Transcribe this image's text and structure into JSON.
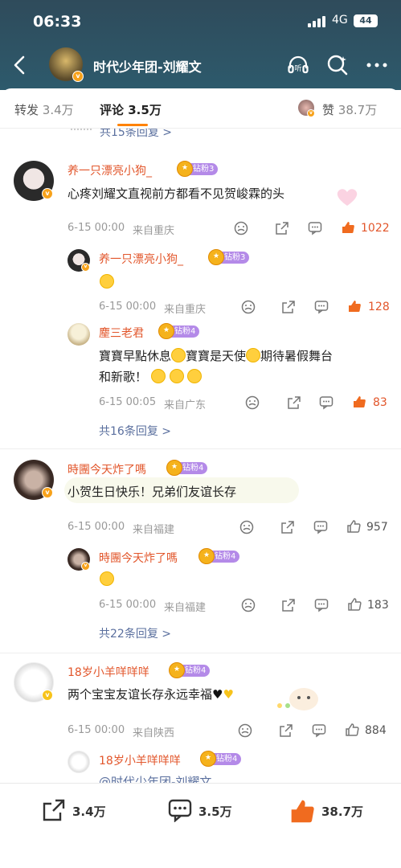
{
  "status_bar": {
    "time": "06:33",
    "network": "4G",
    "battery": "44"
  },
  "nav": {
    "title": "时代少年团-刘耀文",
    "icons": [
      "back-icon",
      "listen-icon",
      "search-icon",
      "more-icon"
    ],
    "listen_label": "听"
  },
  "tabs": {
    "repost_label": "转发",
    "repost_count": "3.4万",
    "comment_label": "评论",
    "comment_count": "3.5万",
    "like_label": "赞",
    "like_count": "38.7万"
  },
  "colors": {
    "accent": "#ff8200",
    "username": "#e2562b",
    "link": "#5a6f9e",
    "fan_badge": "#b48ae8"
  },
  "top_partial": {
    "replies": "共15条回复 >"
  },
  "comments": [
    {
      "user": "养一只漂亮小狗_",
      "badge": "钻粉3",
      "text": "心疼刘耀文直视前方都看不见贺峻霖的头",
      "date": "6-15 00:00",
      "location": "来自重庆",
      "likes": "1022",
      "replies": [
        {
          "user": "养一只漂亮小狗_",
          "badge": "钻粉3",
          "text": "",
          "date": "6-15 00:00",
          "location": "来自重庆",
          "likes": "128"
        },
        {
          "user": "麈三老君",
          "badge": "钻粉4",
          "text_line1a": "寶寶早點休息",
          "text_line1b": "寶寶是天使",
          "text_line1c": "期待暑假舞台",
          "text_line2": "和新歌！",
          "date": "6-15 00:05",
          "location": "来自广东",
          "likes": "83"
        }
      ],
      "more_replies": "共16条回复 >"
    },
    {
      "user": "時團今天炸了嗎",
      "badge": "钻粉4",
      "text": "小贺生日快乐！兄弟们友谊长存",
      "date": "6-15 00:00",
      "location": "来自福建",
      "likes": "957",
      "replies": [
        {
          "user": "時團今天炸了嗎",
          "badge": "钻粉4",
          "text": "",
          "date": "6-15 00:00",
          "location": "来自福建",
          "likes": "183"
        }
      ],
      "more_replies": "共22条回复 >"
    },
    {
      "user": "18岁小羊咩咩咩",
      "badge": "钻粉4",
      "text": "两个宝宝友谊长存永远幸福",
      "date": "6-15 00:00",
      "location": "来自陕西",
      "likes": "884",
      "replies": [
        {
          "user": "18岁小羊咩咩咩",
          "badge": "钻粉4",
          "text": "@时代少年团-刘耀文"
        }
      ]
    }
  ],
  "bottom_bar": {
    "repost": "3.4万",
    "comment": "3.5万",
    "like": "38.7万"
  }
}
